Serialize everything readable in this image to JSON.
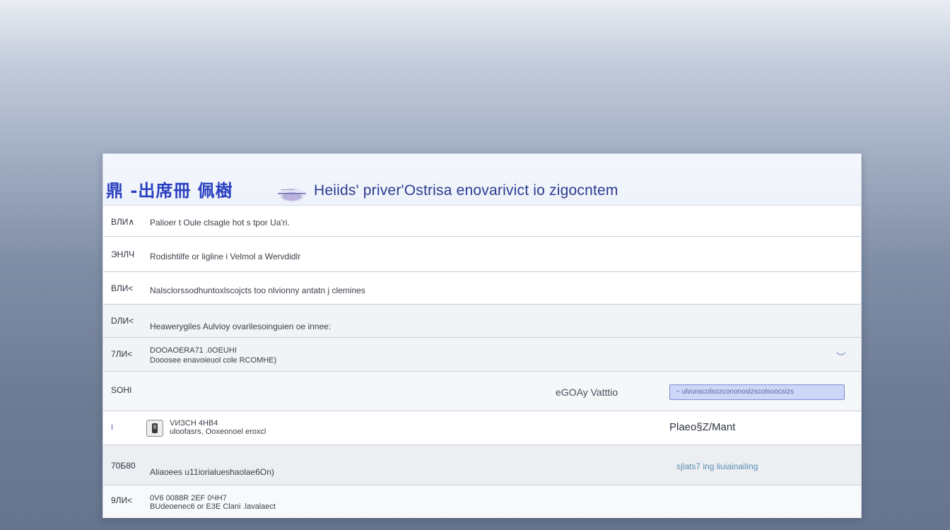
{
  "header": {
    "logo": "鼎 -出席冊 佩樹",
    "title": "Heiids' priver'Ostrisa enovarivict io zigocntem"
  },
  "rows": [
    {
      "code": "ВЛИ∧",
      "text": "Palioer t Oule clsagle hot s tpor Ua'ri.",
      "text2": ""
    },
    {
      "code": "ЭHЛЧ",
      "text": "Rodishtilfe or ligline i Velmol a Wervdidlr",
      "text2": ""
    },
    {
      "code": "ВЛИ<",
      "text": "Nalsclorssodhuntoxlscojcts too nlvionny antatn j clemines",
      "text2": ""
    },
    {
      "code": "DЛИ<",
      "text": "Heawerygiles Aulvioy ovarilesoinguien oe innee:",
      "text2": ""
    },
    {
      "code": "7ЛИ<",
      "text": "DOOAOERA71 .0OEUHI",
      "text2": "Dooosee enavoieuol cole RCOMHE)"
    }
  ],
  "control_row": {
    "code": "SOHI",
    "label": "eGOAy Vatttio",
    "input_value": "~ ulvunscolsozcononoslzscolsoocsizs"
  },
  "media_row": {
    "dot": "I",
    "line1": "VИЗCH 4HB4",
    "line2": "uloofasrs, Ooxeonoel eroxcl",
    "right": "Plaeo§Z/Mant"
  },
  "rows2": [
    {
      "code": "70Б80",
      "text": "Aliaoees u11iorialueshaolae6On)",
      "text2": "",
      "right": "sjlats7 ing liuiainailing"
    },
    {
      "code": "9ЛИ<",
      "text": "0V6 0088R 2EF 0ЧH7",
      "text2": "BUdeoenec6 or E3E Clani .lavalaect",
      "right": ""
    }
  ],
  "colors": {
    "accent": "#2a3fc0",
    "field_bg": "#cdd7f7",
    "field_border": "#7f8fd6",
    "link": "#5b8fb3"
  },
  "icons": [
    "badge-icon",
    "chevron-down-icon",
    "thumbnail-icon"
  ]
}
